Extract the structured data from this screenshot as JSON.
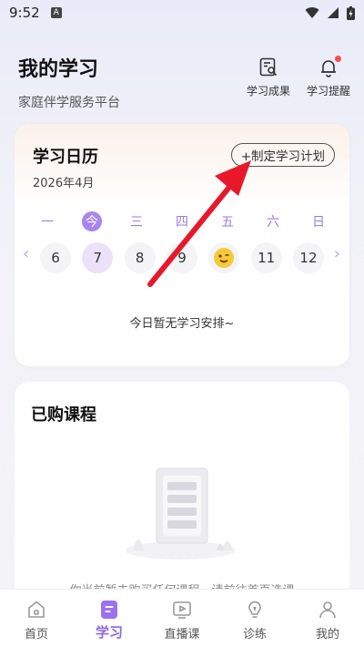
{
  "status_bar": {
    "time": "9:52",
    "notification_letter": "A"
  },
  "header": {
    "title": "我的学习",
    "subtitle": "家庭伴学服务平台",
    "actions": [
      {
        "label": "学习成果",
        "icon": "report-search-icon"
      },
      {
        "label": "学习提醒",
        "icon": "bell-icon",
        "has_badge": true
      }
    ]
  },
  "calendar": {
    "title": "学习日历",
    "month": "2026年4月",
    "plan_button": "+制定学习计划",
    "weekdays": [
      "一",
      "今",
      "三",
      "四",
      "五",
      "六",
      "日"
    ],
    "days": [
      "6",
      "7",
      "8",
      "9",
      "",
      "11",
      "12"
    ],
    "selected_index": 1,
    "emoji_index": 4,
    "empty_text": "今日暂无学习安排~"
  },
  "courses": {
    "title": "已购课程",
    "empty_text": "你当前暂未购买任何课程，请前往首页选课"
  },
  "nav": {
    "items": [
      {
        "label": "首页",
        "icon": "home-icon"
      },
      {
        "label": "学习",
        "icon": "study-icon",
        "active": true
      },
      {
        "label": "直播课",
        "icon": "live-icon"
      },
      {
        "label": "诊练",
        "icon": "lightbulb-icon"
      },
      {
        "label": "我的",
        "icon": "profile-icon"
      }
    ]
  },
  "colors": {
    "accent": "#8f66e6",
    "annotation": "#e8182a"
  }
}
